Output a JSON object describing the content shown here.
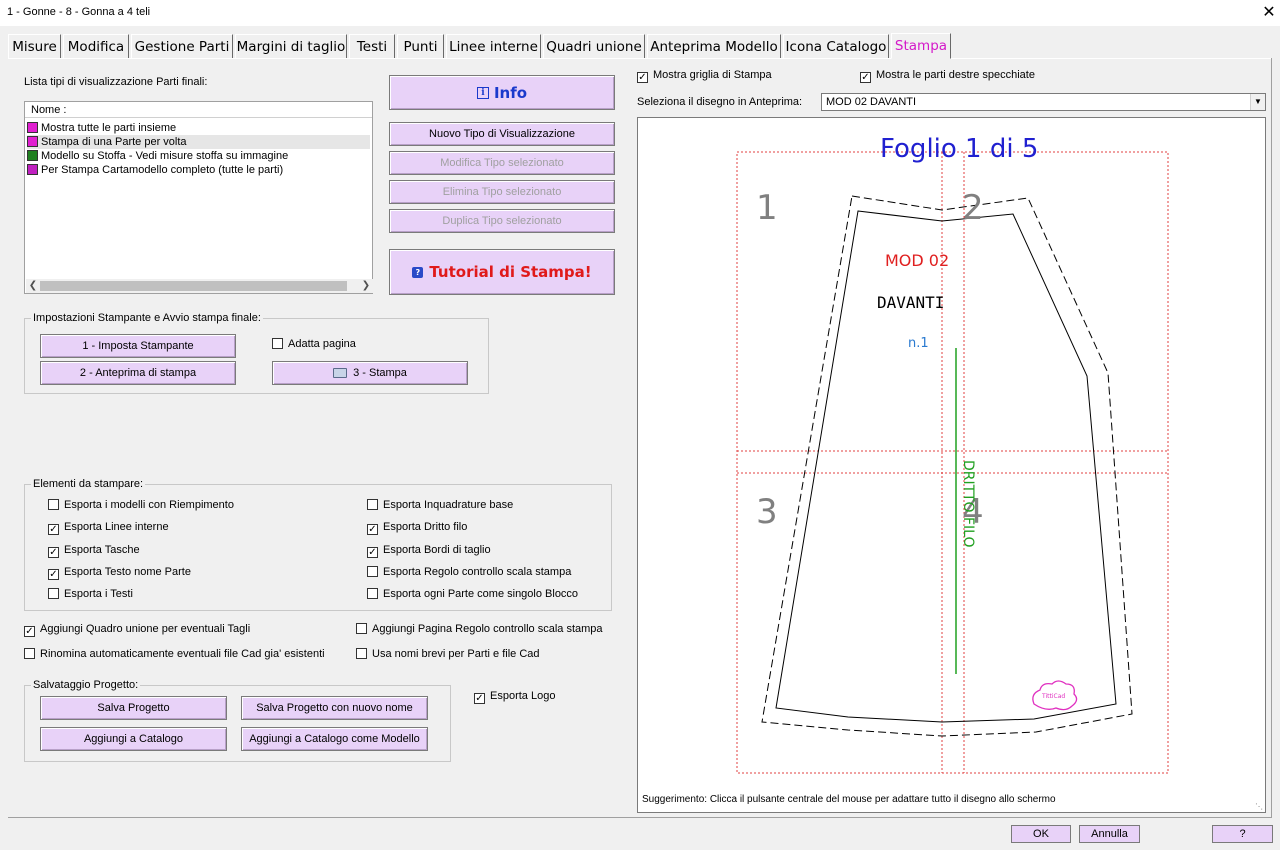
{
  "window": {
    "title": "1 - Gonne -  8 - Gonna a 4 teli",
    "close_glyph": "✕"
  },
  "tabs": [
    "Misure",
    "Modifica",
    "Gestione Parti",
    "Margini di taglio",
    "Testi",
    "Punti",
    "Linee interne",
    "Quadri unione",
    "Anteprima Modello",
    "Icona Catalogo",
    "Stampa"
  ],
  "active_tab": "Stampa",
  "left": {
    "list_label": "Lista tipi di visualizzazione  Parti finali:",
    "list_header": "Nome :",
    "list_items": [
      {
        "label": "Mostra tutte le parti insieme",
        "icon_color": "#e020d0"
      },
      {
        "label": "Stampa di una Parte per volta",
        "icon_color": "#e020d0"
      },
      {
        "label": "Modello su Stoffa - Vedi misure stoffa su immagine",
        "icon_color": "#208020"
      },
      {
        "label": "Per Stampa Cartamodello completo (tutte le parti)",
        "icon_color": "#c020c0"
      }
    ],
    "info_button": "Info",
    "info_badge": "i",
    "new_type_button": "Nuovo Tipo di Visualizzazione",
    "edit_type_button": "Modifica Tipo selezionato",
    "delete_type_button": "Elimina Tipo selezionato",
    "duplicate_type_button": "Duplica Tipo selezionato",
    "tutorial_button": "Tutorial di Stampa!",
    "tutorial_badge": "?",
    "printer_group": {
      "title": "Impostazioni Stampante e Avvio stampa finale:",
      "setup_button": "1 - Imposta Stampante",
      "preview_button": "2 - Anteprima di stampa",
      "print_button": "3 - Stampa",
      "fit_page": {
        "label": "Adatta pagina",
        "checked": false
      }
    },
    "elements_group": {
      "title": "Elementi da stampare:",
      "col1": [
        {
          "label": "Esporta i modelli con Riempimento",
          "checked": false
        },
        {
          "label": "Esporta Linee interne",
          "checked": true
        },
        {
          "label": "Esporta Tasche",
          "checked": true
        },
        {
          "label": "Esporta Testo nome Parte",
          "checked": true
        },
        {
          "label": "Esporta i Testi",
          "checked": false
        }
      ],
      "col2": [
        {
          "label": "Esporta Inquadrature base",
          "checked": false
        },
        {
          "label": "Esporta Dritto filo",
          "checked": true
        },
        {
          "label": "Esporta Bordi di taglio",
          "checked": true
        },
        {
          "label": "Esporta Regolo controllo scala stampa",
          "checked": false
        },
        {
          "label": "Esporta ogni Parte come singolo Blocco",
          "checked": false
        }
      ]
    },
    "extra": {
      "add_joint": {
        "label": "Aggiungi Quadro unione per eventuali Tagli",
        "checked": true
      },
      "add_ruler_page": {
        "label": "Aggiungi Pagina Regolo controllo scala stampa",
        "checked": false
      },
      "rename_cad": {
        "label": "Rinomina automaticamente eventuali file Cad gia' esistenti",
        "checked": false
      },
      "short_names": {
        "label": "Usa nomi brevi per Parti e file Cad",
        "checked": false
      }
    },
    "save_group": {
      "title": "Salvataggio Progetto:",
      "save": "Salva Progetto",
      "save_as": "Salva Progetto con nuovo nome",
      "add_catalog": "Aggiungi a Catalogo",
      "add_catalog_model": "Aggiungi a Catalogo come Modello"
    },
    "export_logo": {
      "label": "Esporta Logo",
      "checked": true
    }
  },
  "right": {
    "show_grid": {
      "label": "Mostra griglia di Stampa",
      "checked": true
    },
    "mirror_parts": {
      "label": "Mostra le parti destre specchiate",
      "checked": true
    },
    "select_label": "Seleziona il disegno in Anteprima:",
    "selected_drawing": "MOD 02 DAVANTI",
    "preview": {
      "sheet_title": "Foglio 1 di 5",
      "page_numbers": [
        "1",
        "2",
        "3",
        "4"
      ],
      "model_code": "MOD 02",
      "part_name": "DAVANTI",
      "part_count": "n.1",
      "grain_label": "DRITTO FILO",
      "logo_text": "TittiCad",
      "hint": "Suggerimento: Clicca il pulsante centrale del mouse per adattare tutto il disegno allo schermo",
      "colors": {
        "title": "#2020d0",
        "model": "#e02020",
        "count": "#2a7ad0",
        "grain": "#20a020",
        "grid": "#e04040",
        "logo": "#e030c0"
      }
    }
  },
  "footer": {
    "ok": "OK",
    "cancel": "Annulla",
    "help": "?"
  }
}
